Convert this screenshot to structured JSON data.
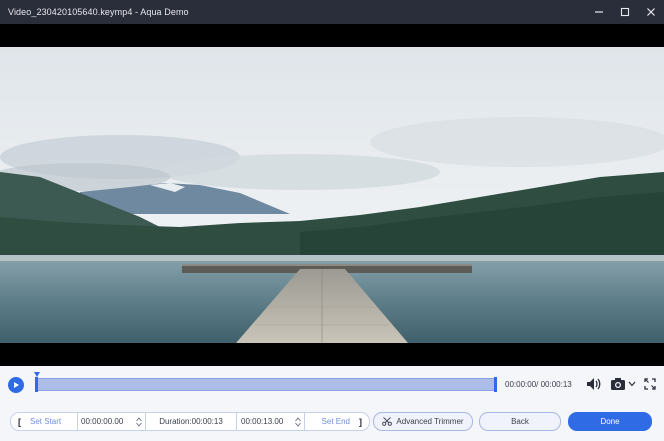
{
  "window": {
    "title": "Video_230420105640.keymp4  -  Aqua Demo"
  },
  "colors": {
    "accent": "#2f6be5",
    "titlebar": "#2a2d3a",
    "timeline_fill": "#aebde8"
  },
  "icons": {
    "minimize": "minimize-icon",
    "maximize": "maximize-icon",
    "close": "close-icon",
    "play": "play-icon",
    "volume": "volume-icon",
    "snapshot": "camera-icon",
    "fullscreen": "fullscreen-icon"
  },
  "player": {
    "timecode": "00:00:00/ 00:00:13",
    "trim_start_fraction": 0.0,
    "trim_end_fraction": 1.0,
    "playhead_fraction": 0.0
  },
  "trim": {
    "open_bracket": "[",
    "set_start_label": "Set Start",
    "start_time": "00:00:00.00",
    "duration_label": "Duration:00:00:13",
    "end_time": "00:00:13.00",
    "set_end_label": "Set End",
    "close_bracket": "]"
  },
  "actions": {
    "advanced_trimmer_label": "Advanced Trimmer",
    "back_label": "Back",
    "done_label": "Done"
  }
}
